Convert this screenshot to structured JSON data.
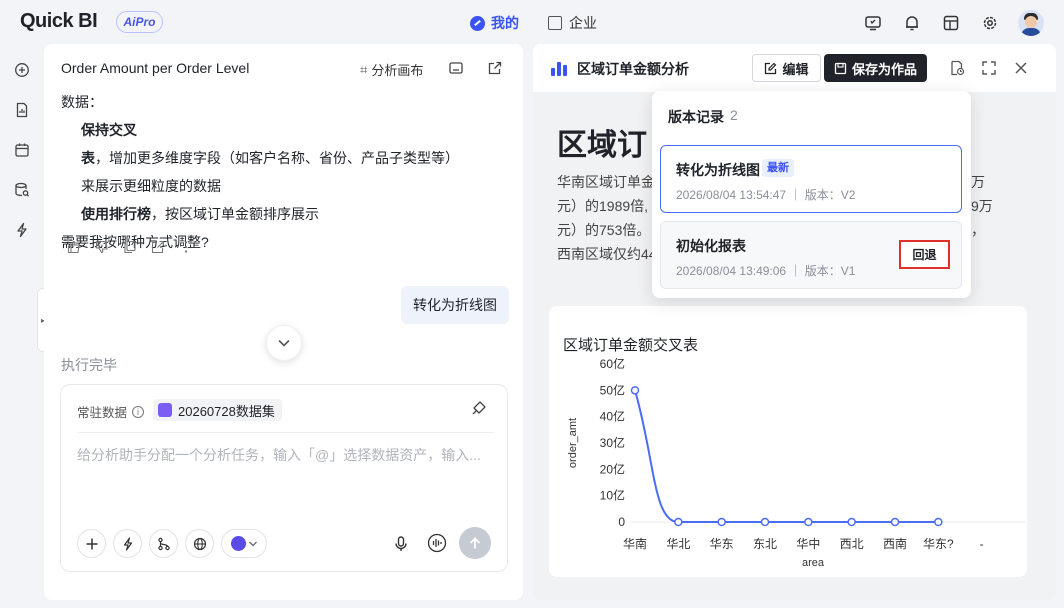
{
  "app": {
    "logo": "Quick BI",
    "badge": "AiPro"
  },
  "nav": {
    "mine": "我的",
    "enterprise": "企业"
  },
  "chat": {
    "title": "Order Amount per Order Level",
    "canvas_button": "分析画布",
    "body": {
      "data_label": "数据：",
      "keep_bold": "保持交叉表",
      "keep_text": "，增加更多维度字段（如客户名称、省份、产品子类型等）",
      "keep_text2": "来展示更细粒度的数据",
      "rank_bold": "使用排行榜",
      "rank_text": "，按区域订单金额排序展示",
      "question": "需要我按哪种方式调整?"
    },
    "user_message": "转化为折线图",
    "exec_done": "执行完毕",
    "input": {
      "resident_label": "常驻数据",
      "dataset": "20260728数据集",
      "placeholder": "给分析助手分配一个分析任务，输入「@」选择数据资产，输入..."
    }
  },
  "report": {
    "title": "区域订单金额分析",
    "edit_button": "编辑",
    "save_button": "保存为作品",
    "big_title": "区域订",
    "summary_lines": [
      "华南区域订单金",
      "元）的1989倍,",
      "元）的753倍。",
      "西南区域仅约44"
    ],
    "summary_right": [
      "万",
      "9万",
      "，",
      ""
    ]
  },
  "version_popup": {
    "title": "版本记录",
    "count": "2",
    "versions": [
      {
        "name": "转化为折线图",
        "badge": "最新",
        "meta": "2026/08/04 13:54:47 ｜ 版本：V2"
      },
      {
        "name": "初始化报表",
        "meta": "2026/08/04 13:49:06 ｜ 版本：V1",
        "action": "回退"
      }
    ]
  },
  "chart_data": {
    "type": "line",
    "title": "区域订单金额交叉表",
    "xlabel": "area",
    "ylabel": "order_amt",
    "categories": [
      "华南",
      "华北",
      "华东",
      "东北",
      "华中",
      "西北",
      "西南",
      "华东?",
      "-"
    ],
    "series": [
      {
        "values": [
          5000000000,
          0,
          0,
          0,
          0,
          0,
          0,
          0
        ]
      }
    ],
    "yticks": [
      "0",
      "10亿",
      "20亿",
      "30亿",
      "40亿",
      "50亿",
      "60亿"
    ],
    "ylim": [
      0,
      6000000000
    ],
    "color": "#4a6cf7",
    "grid": false
  }
}
